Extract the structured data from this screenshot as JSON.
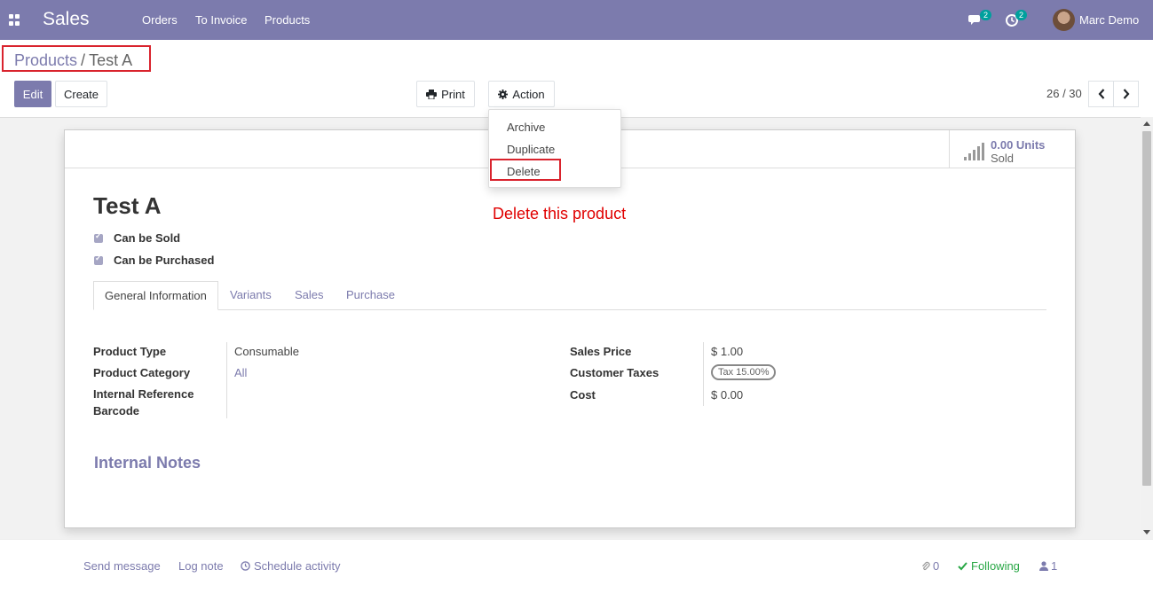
{
  "navbar": {
    "app_name": "Sales",
    "menu": [
      "Orders",
      "To Invoice",
      "Products"
    ],
    "messages_count": "2",
    "activities_count": "2",
    "user_name": "Marc Demo"
  },
  "breadcrumb": {
    "parent": "Products",
    "separator": "/",
    "current": "Test A"
  },
  "buttons": {
    "edit": "Edit",
    "create": "Create",
    "print": "Print",
    "action": "Action"
  },
  "pager": {
    "value": "26 / 30"
  },
  "action_menu": {
    "items": [
      "Archive",
      "Duplicate",
      "Delete"
    ]
  },
  "annotation": "Delete this product",
  "stat": {
    "value": "0.00 Units",
    "label": "Sold"
  },
  "product": {
    "name": "Test A",
    "can_be_sold": "Can be Sold",
    "can_be_purchased": "Can be Purchased"
  },
  "tabs": [
    "General Information",
    "Variants",
    "Sales",
    "Purchase"
  ],
  "fields_left": {
    "product_type_label": "Product Type",
    "product_type_value": "Consumable",
    "category_label": "Product Category",
    "category_value": "All",
    "internal_ref_label": "Internal Reference",
    "barcode_label": "Barcode"
  },
  "fields_right": {
    "sales_price_label": "Sales Price",
    "sales_price_value": "$ 1.00",
    "customer_taxes_label": "Customer Taxes",
    "customer_taxes_value": "Tax 15.00%",
    "cost_label": "Cost",
    "cost_value": "$ 0.00"
  },
  "notes_title": "Internal Notes",
  "chatter": {
    "send_message": "Send message",
    "log_note": "Log note",
    "schedule_activity": "Schedule activity",
    "attachments_count": "0",
    "following": "Following",
    "followers_count": "1"
  },
  "colors": {
    "brand": "#7c7bad",
    "annotation_red": "#d9232d",
    "badge": "#00a09d",
    "following": "#28a745"
  }
}
